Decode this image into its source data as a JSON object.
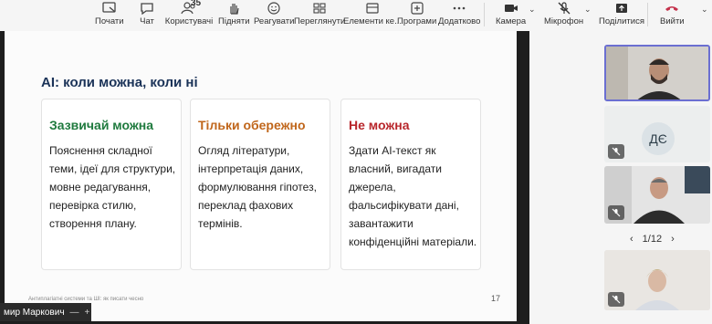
{
  "toolbar": {
    "leave_label": "Почати",
    "chat_label": "Чат",
    "people_label": "Користувачі",
    "people_count": "35",
    "raise_label": "Підняти",
    "react_label": "Реагувати",
    "view_label": "Переглянути",
    "elements_label": "Елементи ке...",
    "apps_label": "Програми",
    "more_label": "Додатково",
    "camera_label": "Камера",
    "mic_label": "Мікрофон",
    "share_label": "Поділитися",
    "exit_label": "Вийти",
    "exit_color": "#c4314b"
  },
  "slide": {
    "title": "AI: коли можна, коли ні",
    "cards": [
      {
        "title": "Зазвичай можна",
        "color": "#1f7a3e",
        "text": "Пояснення складної теми, ідеї для структури, мовне редагування, перевірка стилю, створення плану."
      },
      {
        "title": "Тільки обережно",
        "color": "#c0661b",
        "text": "Огляд літератури, інтерпретація даних, формулювання гіпотез, переклад фахових термінів."
      },
      {
        "title": "Не можна",
        "color": "#b8262b",
        "text": "Здати AI-текст як власний, вигадати джерела, фальсифікувати дані, завантажити конфіденційні матеріали."
      }
    ],
    "footer": "Антиплагіатні системи та ШІ: як писати чесно",
    "page_number": "17"
  },
  "presenter_name": "мир Маркович",
  "participants": {
    "initials": "ДЄ",
    "pager": "1/12"
  }
}
